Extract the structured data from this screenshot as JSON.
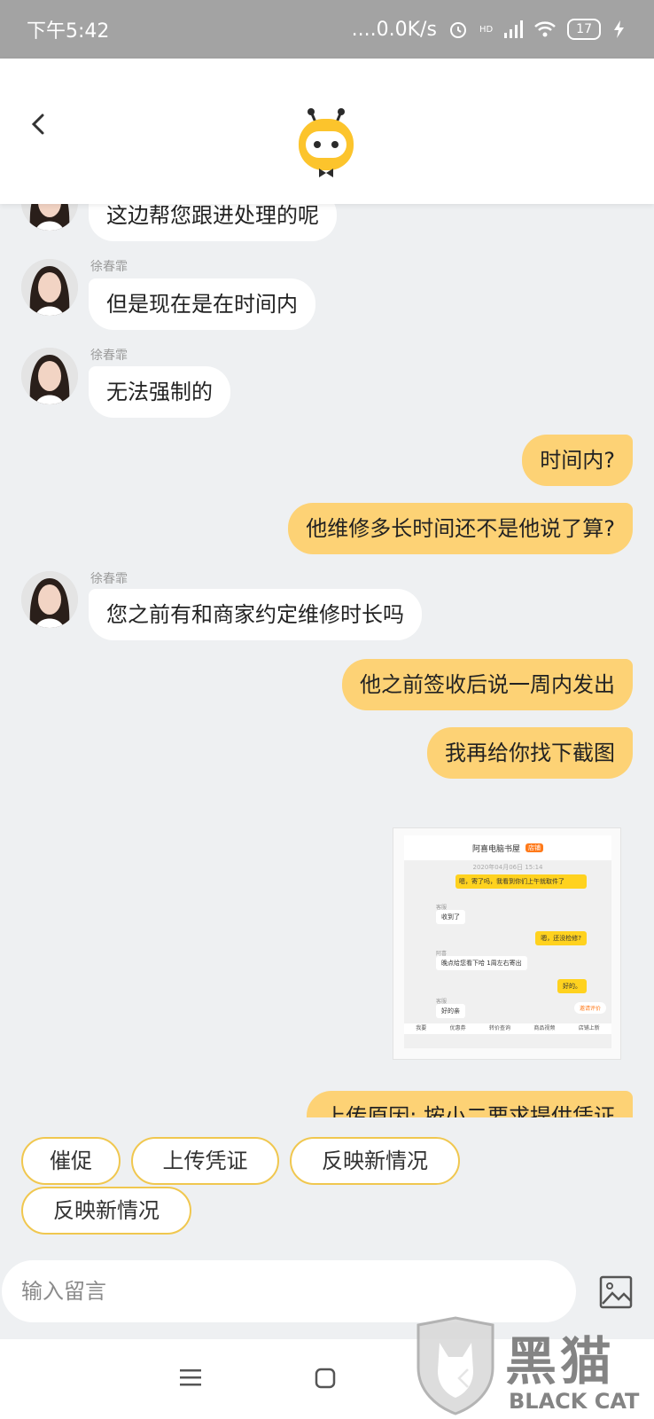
{
  "status_bar": {
    "time": "下午5:42",
    "net_speed": "....0.0K/s",
    "battery": "17",
    "hd_label": "HD"
  },
  "header": {
    "back_icon": "chevron-left-icon",
    "logo": "yellow-bot-logo"
  },
  "messages": [
    {
      "side": "left",
      "sender": "",
      "text": "这边帮您跟进处理的呢"
    },
    {
      "side": "left",
      "sender": "徐春霏",
      "text": "但是现在是在时间内"
    },
    {
      "side": "left",
      "sender": "徐春霏",
      "text": "无法强制的"
    },
    {
      "side": "right",
      "text": "时间内?"
    },
    {
      "side": "right",
      "text": "他维修多长时间还不是他说了算?"
    },
    {
      "side": "left",
      "sender": "徐春霏",
      "text": "您之前有和商家约定维修时长吗"
    },
    {
      "side": "right",
      "text": "他之前签收后说一周内发出"
    },
    {
      "side": "right",
      "text": "我再给你找下截图"
    },
    {
      "side": "right",
      "text": "上传原因: 按小二要求提供凭证"
    }
  ],
  "screenshot_card": {
    "store_name": "阿喜电脑书屋",
    "badge": "店铺",
    "date": "2020年04月06日 15:14",
    "msgs": [
      "嗯，寄了吗，我看到你们上午就取件了",
      "收到了",
      "嗯，还没检修?",
      "晚点给您看下哈 1周左右寄出",
      "好的。",
      "好的亲"
    ],
    "names": [
      "客服",
      "阿喜",
      "客服"
    ],
    "eval_btn": "邀请评价",
    "tabs": [
      "我要",
      "优惠券",
      "转价查询",
      "商品视频",
      "店铺上新"
    ]
  },
  "quick_replies": [
    "催促",
    "上传凭证",
    "反映新情况",
    "反映新情况"
  ],
  "input": {
    "placeholder": "输入留言"
  },
  "watermark": {
    "cn": "黑猫",
    "en": "BLACK CAT"
  },
  "colors": {
    "accent": "#fdd275",
    "chip_border": "#f0c74f",
    "background": "#eef0f2"
  }
}
